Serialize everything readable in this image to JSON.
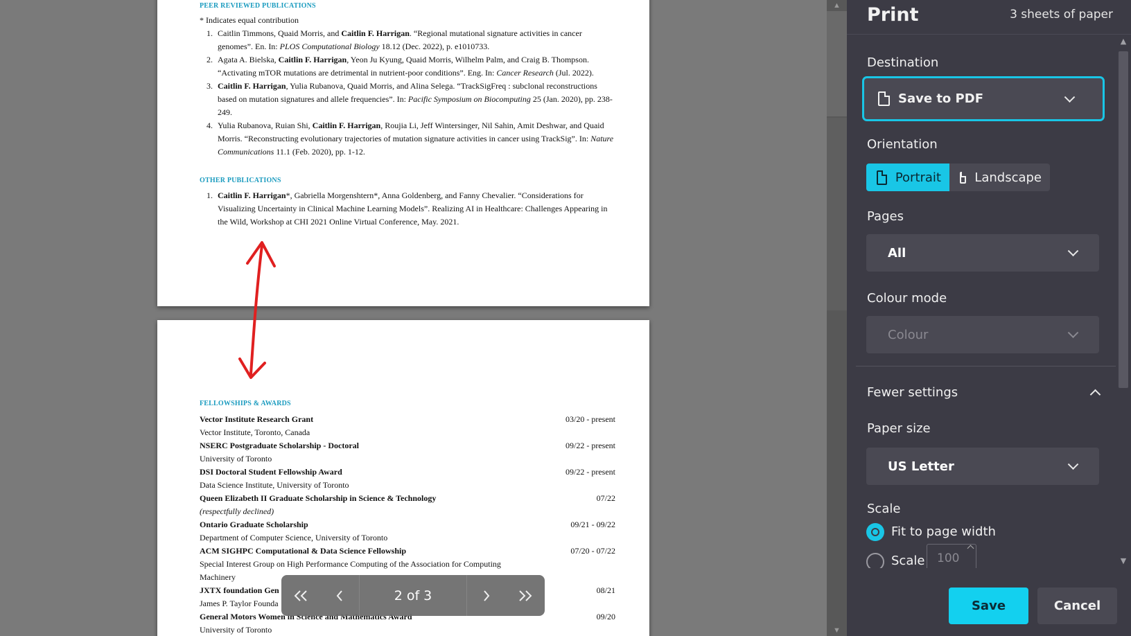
{
  "preview": {
    "page1": {
      "peer_heading": "PEER REVIEWED PUBLICATIONS",
      "equal_note": "* Indicates equal contribution",
      "other_heading": "OTHER PUBLICATIONS"
    },
    "page2": {
      "awards_heading": "FELLOWSHIPS & AWARDS"
    },
    "navigator": {
      "first_icon": "«",
      "prev_icon": "‹",
      "page_indicator": "2 of 3",
      "next_icon": "›",
      "last_icon": "»"
    }
  },
  "publications": [
    {
      "num": "1.",
      "pre": "Caitlin Timmons, Quaid Morris, and ",
      "bold": "Caitlin F. Harrigan",
      "post": ". “Regional mutational signature activities in cancer genomes”. En. In: ",
      "ital": "PLOS Computational Biology",
      "tail": " 18.12 (Dec. 2022), p. e1010733."
    },
    {
      "num": "2.",
      "pre": "Agata A. Bielska, ",
      "bold": "Caitlin F. Harrigan",
      "post": ", Yeon Ju Kyung, Quaid Morris, Wilhelm Palm, and Craig B. Thompson. “Activating mTOR mutations are detrimental in nutrient-poor conditions”. Eng. In: ",
      "ital": "Cancer Research",
      "tail": " (Jul. 2022)."
    },
    {
      "num": "3.",
      "pre": "",
      "bold": "Caitlin F. Harrigan",
      "post": ", Yulia Rubanova, Quaid Morris, and Alina Selega. “TrackSigFreq : subclonal reconstructions based on mutation signatures and allele frequencies”. In: ",
      "ital": "Pacific Symposium on Biocomputing",
      "tail": " 25 (Jan. 2020), pp. 238-249."
    },
    {
      "num": "4.",
      "pre": "Yulia Rubanova, Ruian Shi, ",
      "bold": "Caitlin F. Harrigan",
      "post": ", Roujia Li, Jeff Wintersinger, Nil Sahin, Amit Deshwar, and Quaid Morris. “Reconstructing evolutionary trajectories of mutation signature activities in cancer using TrackSig”. In: ",
      "ital": "Nature Communications",
      "tail": " 11.1 (Feb. 2020), pp. 1-12."
    }
  ],
  "other_publications": [
    {
      "num": "1.",
      "pre": "",
      "bold": "Caitlin F. Harrigan",
      "post": "*, Gabriella Morgenshtern*, Anna Goldenberg, and Fanny Chevalier. “Considerations for Visualizing Uncertainty in Clinical Machine Learning Models”. Realizing AI in Healthcare: Challenges Appearing in the Wild, Workshop at CHI 2021 Online Virtual Conference, May. 2021.",
      "ital": "",
      "tail": ""
    }
  ],
  "awards": [
    {
      "title": "Vector Institute Research Grant",
      "date": "03/20 - present",
      "sub": "Vector Institute, Toronto, Canada",
      "sub_italic": false
    },
    {
      "title": "NSERC Postgraduate Scholarship - Doctoral",
      "date": "09/22 - present",
      "sub": "University of Toronto",
      "sub_italic": false
    },
    {
      "title": "DSI Doctoral Student Fellowship Award",
      "date": "09/22 - present",
      "sub": "Data Science Institute, University of Toronto",
      "sub_italic": false
    },
    {
      "title": "Queen Elizabeth II Graduate Scholarship in Science & Technology",
      "date": "07/22",
      "sub": "(respectfully declined)",
      "sub_italic": true
    },
    {
      "title": "Ontario Graduate Scholarship",
      "date": "09/21 - 09/22",
      "sub": "Department of Computer Science, University of Toronto",
      "sub_italic": false
    },
    {
      "title": "ACM SIGHPC Computational & Data Science Fellowship",
      "date": "07/20 - 07/22",
      "sub": "Special Interest Group on High Performance Computing of the Association for Computing",
      "sub2": "Machinery",
      "sub_italic": false
    },
    {
      "title": "JXTX foundation Gen",
      "date": "08/21",
      "sub": "James P. Taylor Founda",
      "sub_italic": false
    },
    {
      "title": "General Motors Women in Science and Mathematics Award",
      "date": "09/20",
      "sub": "University of Toronto",
      "sub_italic": false
    }
  ],
  "print_panel": {
    "title": "Print",
    "sheets": "3 sheets of paper",
    "destination_label": "Destination",
    "destination_value": "Save to PDF",
    "orientation_label": "Orientation",
    "portrait_label": "Portrait",
    "landscape_label": "Landscape",
    "pages_label": "Pages",
    "pages_value": "All",
    "colour_label": "Colour mode",
    "colour_value": "Colour",
    "fewer_settings": "Fewer settings",
    "paper_size_label": "Paper size",
    "paper_size_value": "US Letter",
    "scale_label": "Scale",
    "fit_width_label": "Fit to page width",
    "scale_option_label": "Scale",
    "scale_value": "100",
    "save_label": "Save",
    "cancel_label": "Cancel"
  },
  "colors": {
    "accent": "#19c6e6",
    "section_heading": "#1a9bbf",
    "panel_bg": "#3c3b45",
    "annotation_arrow": "#e02020"
  },
  "icons": {
    "destination": "pdf-document-icon",
    "portrait": "portrait-page-icon",
    "landscape": "landscape-page-icon"
  }
}
